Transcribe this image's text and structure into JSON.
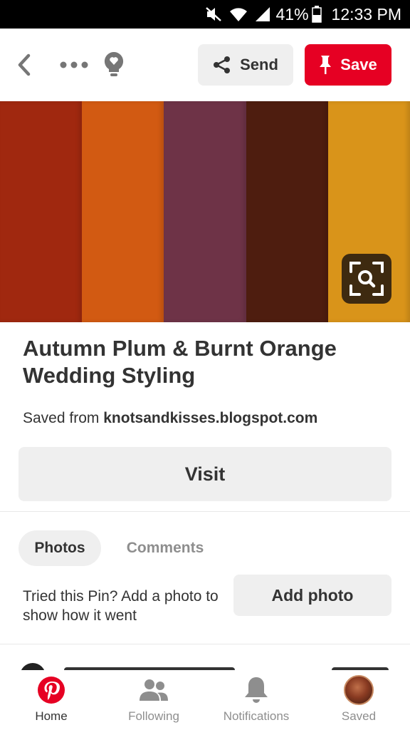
{
  "status_bar": {
    "battery_percent": "41%",
    "time": "12:33 PM",
    "icons": [
      "mute-icon",
      "wifi-icon",
      "signal-icon",
      "battery-icon"
    ]
  },
  "toolbar": {
    "send_label": "Send",
    "save_label": "Save",
    "icons": [
      "back-icon",
      "more-icon",
      "lightbulb-icon",
      "share-icon",
      "pin-icon"
    ]
  },
  "pin": {
    "swatches": [
      "#a0280f",
      "#d25a12",
      "#6e3347",
      "#4e1d0f",
      "#d9941a"
    ],
    "lens_icon": "visual-search-icon",
    "title": "Autumn Plum & Burnt Orange Wedding Styling",
    "source_prefix": "Saved from",
    "source_domain": "knotsandkisses.blogspot.com",
    "visit_label": "Visit"
  },
  "tabs": [
    {
      "label": "Photos",
      "active": true
    },
    {
      "label": "Comments",
      "active": false
    }
  ],
  "tried": {
    "text": "Tried this Pin? Add a photo to show how it went",
    "button_label": "Add photo"
  },
  "colors": {
    "brand_red": "#e60023",
    "button_gray": "#efefef",
    "text_dark": "#333333",
    "text_muted": "#8e8e8e"
  },
  "bottom_nav": {
    "items": [
      {
        "label": "Home",
        "icon": "pinterest-logo-icon",
        "active": true
      },
      {
        "label": "Following",
        "icon": "people-icon",
        "active": false
      },
      {
        "label": "Notifications",
        "icon": "bell-icon",
        "active": false
      },
      {
        "label": "Saved",
        "icon": "profile-avatar",
        "active": false
      }
    ]
  }
}
